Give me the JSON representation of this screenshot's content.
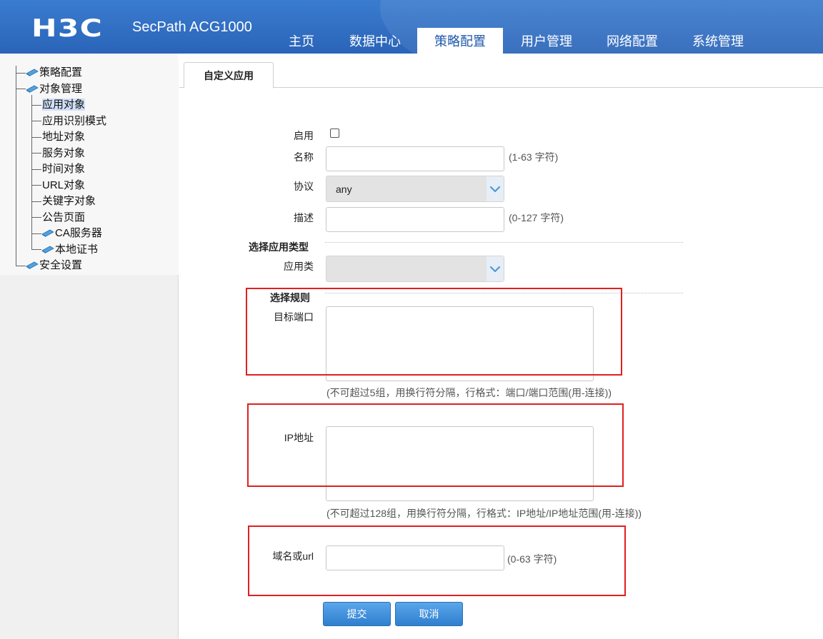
{
  "header": {
    "logo": "H3C",
    "product": "SecPath ACG1000",
    "nav": [
      {
        "label": "主页"
      },
      {
        "label": "数据中心"
      },
      {
        "label": "策略配置",
        "active": true
      },
      {
        "label": "用户管理"
      },
      {
        "label": "网络配置"
      },
      {
        "label": "系统管理"
      }
    ]
  },
  "sidebar": {
    "items": [
      {
        "label": "策略配置",
        "icon": "book-icon"
      },
      {
        "label": "对象管理",
        "icon": "book-icon"
      },
      {
        "label": "应用对象",
        "selected": true
      },
      {
        "label": "应用识别模式"
      },
      {
        "label": "地址对象"
      },
      {
        "label": "服务对象"
      },
      {
        "label": "时间对象"
      },
      {
        "label": "URL对象"
      },
      {
        "label": "关键字对象"
      },
      {
        "label": "公告页面"
      },
      {
        "label": "CA服务器",
        "icon": "book-icon"
      },
      {
        "label": "本地证书",
        "icon": "book-icon"
      },
      {
        "label": "安全设置",
        "icon": "book-icon"
      }
    ]
  },
  "tab": {
    "label": "自定义应用"
  },
  "form": {
    "enable": {
      "label": "启用",
      "checked": false
    },
    "name": {
      "label": "名称",
      "value": "",
      "hint": "(1-63 字符)"
    },
    "protocol": {
      "label": "协议",
      "value": "any"
    },
    "description": {
      "label": "描述",
      "value": "",
      "hint": "(0-127 字符)"
    },
    "app_type_section": "选择应用类型",
    "app_class": {
      "label": "应用类",
      "value": ""
    },
    "rule_section": "选择规则",
    "dest_port": {
      "label": "目标端口",
      "value": "",
      "hint": "(不可超过5组，用换行符分隔，行格式：端口/端口范围(用-连接))"
    },
    "ip_address": {
      "label": "IP地址",
      "value": "",
      "hint": "(不可超过128组，用换行符分隔，行格式：IP地址/IP地址范围(用-连接))"
    },
    "domain": {
      "label": "域名或url",
      "value": "",
      "hint": "(0-63 字符)"
    }
  },
  "buttons": {
    "submit": "提交",
    "cancel": "取消"
  },
  "colors": {
    "header_blue": "#2a64b8",
    "highlight_red": "#e02020",
    "button_blue": "#2f7fcf"
  }
}
